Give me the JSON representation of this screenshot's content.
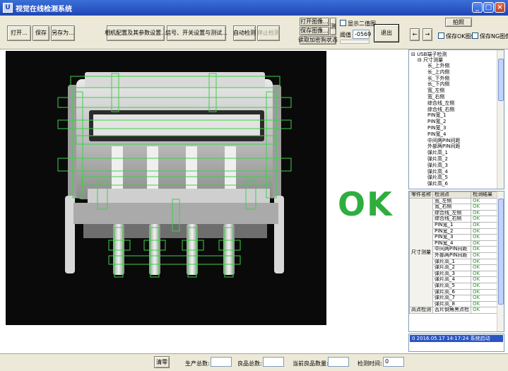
{
  "window": {
    "title": "视觉在线检测系统",
    "app_icon_label": "U"
  },
  "toolbar": {
    "open_label": "打开...",
    "save_label": "保存",
    "save_as_label": "另存为...",
    "model_config_label": "相机配置及其参数设置...",
    "signal_settings_label": "信号、开关设置与测试...",
    "auto_detect_label": "自动检测",
    "stop_detect_label": "停止检测",
    "open_image_label": "打开图像...",
    "save_image_label": "保存图像...",
    "read_encrypt_label": "读取加密狗状态",
    "small_side_label": "测",
    "show_binary_label": "显示二值图",
    "threshold_label": "阈值",
    "threshold_value": "-0569",
    "exit_label": "退出",
    "capture_label": "拍照",
    "prev_label": "←",
    "next_label": "→",
    "save_ok_label": "保存OK图像",
    "save_ng_label": "保存NG图像"
  },
  "tree": {
    "root": "USB端子检测",
    "group": "尺寸测量",
    "items": [
      "长_上外侧",
      "长_上内侧",
      "长_下外侧",
      "长_下内侧",
      "宽_左侧",
      "宽_右侧",
      "综合线_左侧",
      "综合线_右侧",
      "PIN宽_1",
      "PIN宽_2",
      "PIN宽_3",
      "PIN宽_4",
      "中间两PIN间距",
      "外部两PIN间距",
      "弹片高_1",
      "弹片高_2",
      "弹片高_3",
      "弹片高_4",
      "弹片高_5",
      "弹片高_6"
    ]
  },
  "result": {
    "text": "OK"
  },
  "grid": {
    "headers": [
      "零件名称",
      "检测点",
      "检测结果"
    ],
    "category_size": "尺寸测量",
    "category_corner": "高点检测",
    "rows": [
      {
        "point": "宽_左侧",
        "result": "OK"
      },
      {
        "point": "宽_右侧",
        "result": "OK"
      },
      {
        "point": "综合线_左侧",
        "result": "OK"
      },
      {
        "point": "综合线_右侧",
        "result": "OK"
      },
      {
        "point": "PIN宽_1",
        "result": "OK"
      },
      {
        "point": "PIN宽_2",
        "result": "OK"
      },
      {
        "point": "PIN宽_3",
        "result": "OK"
      },
      {
        "point": "PIN宽_4",
        "result": "OK"
      },
      {
        "point": "中间两PIN间距",
        "result": "OK"
      },
      {
        "point": "外部两PIN间距",
        "result": "OK"
      },
      {
        "point": "弹片高_1",
        "result": "OK"
      },
      {
        "point": "弹片高_2",
        "result": "OK"
      },
      {
        "point": "弹片高_3",
        "result": "OK"
      },
      {
        "point": "弹片高_4",
        "result": "OK"
      },
      {
        "point": "弹片高_5",
        "result": "OK"
      },
      {
        "point": "弹片高_6",
        "result": "OK"
      },
      {
        "point": "弹片高_7",
        "result": "OK"
      },
      {
        "point": "弹片高_8",
        "result": "OK"
      }
    ],
    "last_row": {
      "point": "舌片倒角黑点检",
      "result": "OK"
    }
  },
  "log": {
    "entry": "0   2016.05.17  14:17:24  系统启动"
  },
  "bottom": {
    "clear_label": "清零",
    "total_label": "生产总数:",
    "total_value": "",
    "good_label": "良品总数:",
    "good_value": "",
    "current_good_label": "当前良品数量:",
    "current_good_value": "",
    "time_label": "检测时间:",
    "time_value": "0"
  },
  "colors": {
    "titlebar": "#2a56c4",
    "ok_green": "#2fae3e",
    "overlay_green": "#3fd04a"
  }
}
